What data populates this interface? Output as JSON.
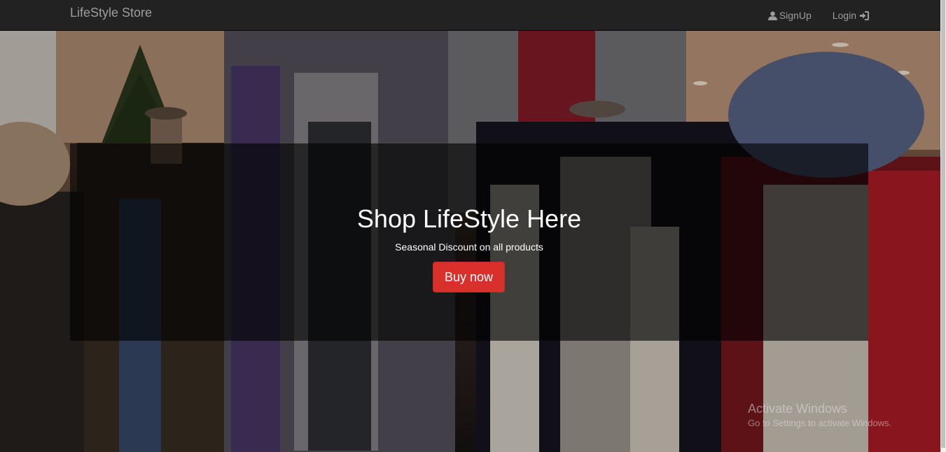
{
  "navbar": {
    "brand": "LifeStyle Store",
    "signup_label": "SignUp",
    "login_label": "Login"
  },
  "hero": {
    "title": "Shop LifeStyle Here",
    "subtitle": "Seasonal Discount on all products",
    "cta_label": "Buy now"
  },
  "watermark": {
    "line1": "Activate Windows",
    "line2": "Go to Settings to activate Windows."
  },
  "colors": {
    "navbar_bg": "#222222",
    "nav_text": "#9d9d9d",
    "cta_bg": "#d9302c"
  },
  "icons": [
    "user-icon",
    "login-icon"
  ]
}
